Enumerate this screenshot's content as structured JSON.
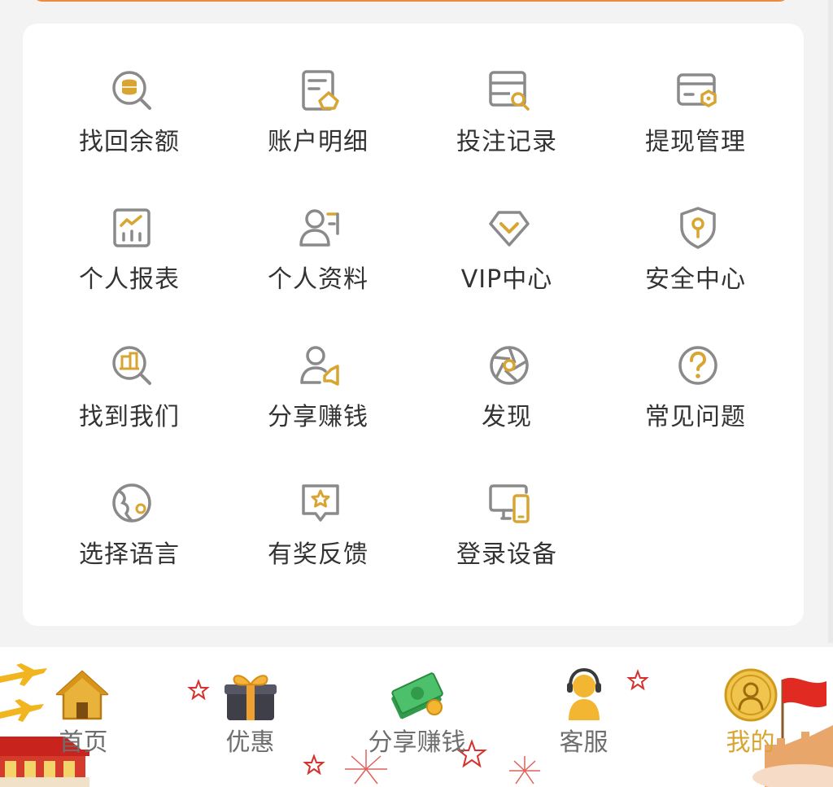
{
  "menu": {
    "items": [
      {
        "label": "找回余额",
        "icon": "balance-search-icon"
      },
      {
        "label": "账户明细",
        "icon": "account-detail-icon"
      },
      {
        "label": "投注记录",
        "icon": "bet-record-icon"
      },
      {
        "label": "提现管理",
        "icon": "withdraw-card-icon"
      },
      {
        "label": "个人报表",
        "icon": "report-chart-icon"
      },
      {
        "label": "个人资料",
        "icon": "profile-icon"
      },
      {
        "label": "VIP中心",
        "icon": "vip-diamond-icon"
      },
      {
        "label": "安全中心",
        "icon": "security-shield-icon"
      },
      {
        "label": "找到我们",
        "icon": "find-us-icon"
      },
      {
        "label": "分享赚钱",
        "icon": "share-user-icon"
      },
      {
        "label": "发现",
        "icon": "discover-aperture-icon"
      },
      {
        "label": "常见问题",
        "icon": "question-icon"
      },
      {
        "label": "选择语言",
        "icon": "language-globe-icon"
      },
      {
        "label": "有奖反馈",
        "icon": "feedback-star-icon"
      },
      {
        "label": "登录设备",
        "icon": "devices-icon"
      }
    ]
  },
  "tabbar": {
    "tabs": [
      {
        "label": "首页",
        "icon": "home-icon"
      },
      {
        "label": "优惠",
        "icon": "gift-icon"
      },
      {
        "label": "分享赚钱",
        "icon": "money-icon"
      },
      {
        "label": "客服",
        "icon": "customer-service-icon"
      },
      {
        "label": "我的",
        "icon": "user-coin-icon",
        "active": true
      }
    ]
  },
  "colors": {
    "icon_gray": "#8a8a8a",
    "icon_gold": "#d9a532",
    "label": "#333333",
    "tab_label": "#6e6e6e",
    "tab_active": "#d9a532",
    "accent_orange": "#ef8a3c"
  }
}
